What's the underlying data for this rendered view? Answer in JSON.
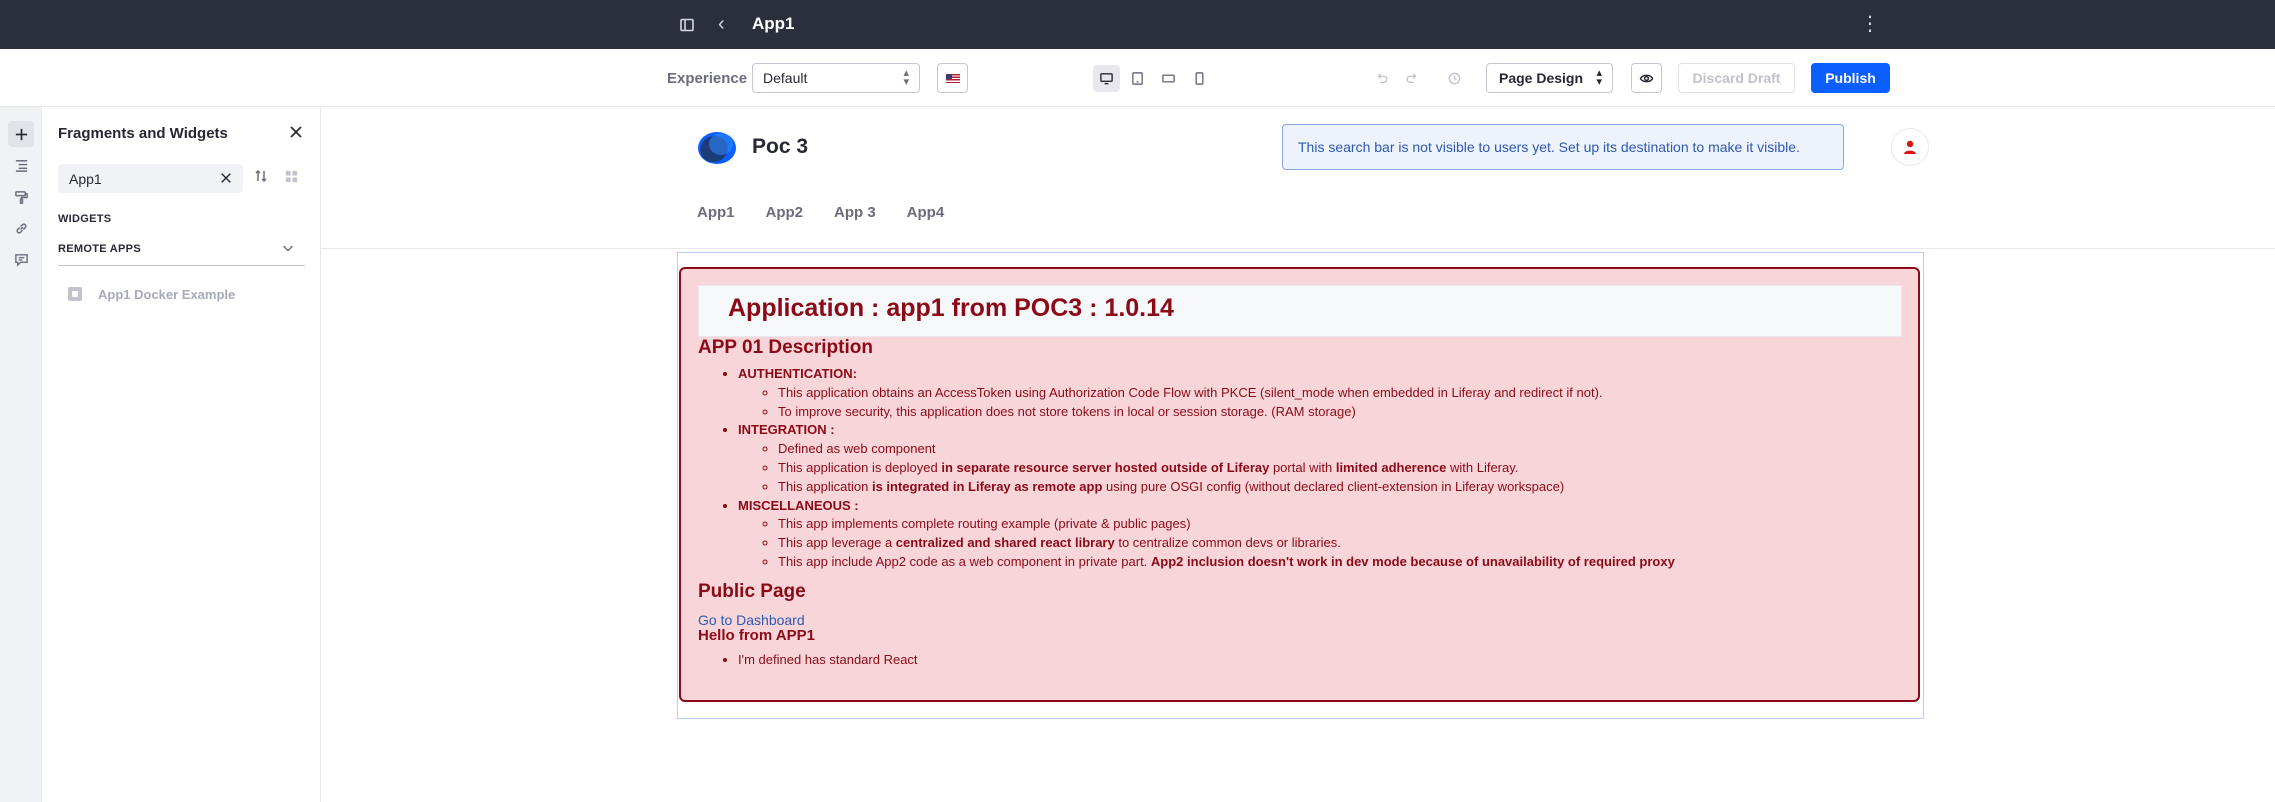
{
  "topbar": {
    "title": "App1"
  },
  "toolbar": {
    "experience_label": "Experience",
    "experience_value": "Default",
    "page_design_value": "Page Design",
    "discard_label": "Discard Draft",
    "publish_label": "Publish"
  },
  "panel": {
    "title": "Fragments and Widgets",
    "search_value": "App1",
    "section_widgets": "WIDGETS",
    "section_remote": "REMOTE APPS",
    "widget_item": "App1 Docker Example"
  },
  "site": {
    "name": "Poc 3",
    "search_alert": "This search bar is not visible to users yet. Set up its destination to make it visible.",
    "nav": [
      "App1",
      "App2",
      "App 3",
      "App4"
    ]
  },
  "app": {
    "title": "Application : app1 from POC3 : 1.0.14",
    "desc_title": "APP 01 Description",
    "auth_heading": "AUTHENTICATION:",
    "auth_items": [
      "This application obtains an AccessToken using Authorization Code Flow with PKCE (silent_mode when embedded in Liferay and redirect if not).",
      "To improve security, this application does not store tokens in local or session storage. (RAM storage)"
    ],
    "integration_heading": "INTEGRATION :",
    "integration_1": "Defined as web component",
    "integration_2_a": "This application is deployed ",
    "integration_2_b": "in separate resource server hosted outside of Liferay",
    "integration_2_c": " portal with ",
    "integration_2_d": "limited adherence",
    "integration_2_e": " with Liferay.",
    "integration_3_a": "This application ",
    "integration_3_b": "is integrated in Liferay as remote app",
    "integration_3_c": " using pure OSGI config (without declared client-extension in Liferay workspace)",
    "misc_heading": "MISCELLANEOUS :",
    "misc_1": "This app implements complete routing example (private & public pages)",
    "misc_2_a": "This app leverage a ",
    "misc_2_b": "centralized and shared react library",
    "misc_2_c": " to centralize common devs or libraries.",
    "misc_3_a": "This app include App2 code as a web component in private part. ",
    "misc_3_b": "App2 inclusion doesn't work in dev mode because of unavailability of required proxy",
    "public_title": "Public Page",
    "dash_link": "Go to Dashboard",
    "hello": "Hello from APP1",
    "hello_item": "I'm defined has standard React"
  }
}
